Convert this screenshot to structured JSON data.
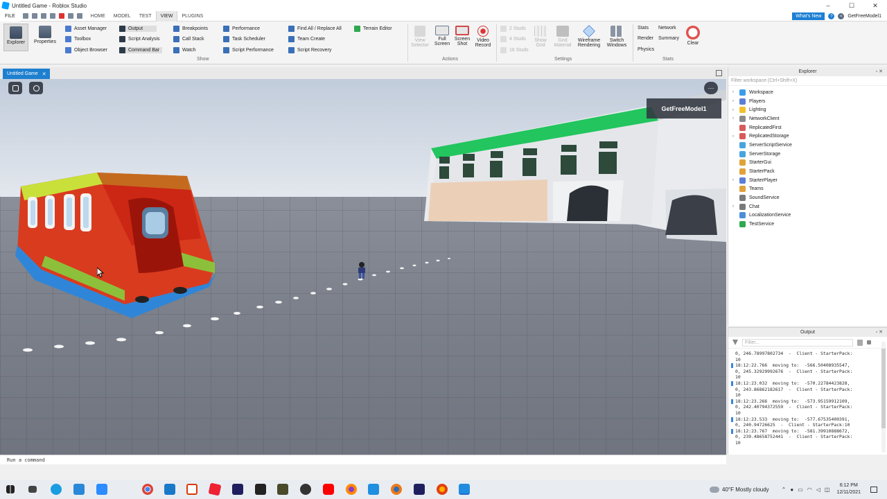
{
  "window": {
    "title": "Untitled Game - Roblox Studio",
    "controls": [
      "–",
      "☐",
      "✕"
    ]
  },
  "menu": {
    "file": "FILE",
    "tabs": [
      "HOME",
      "MODEL",
      "TEST",
      "VIEW",
      "PLUGINS"
    ],
    "active_tab": "VIEW",
    "whats_new": "What's New",
    "user": "GetFreeModel1"
  },
  "ribbon": {
    "explorer": "Explorer",
    "properties": "Properties",
    "show_col1": [
      "Asset Manager",
      "Toolbox",
      "Object Browser"
    ],
    "show_col2": [
      "Output",
      "Script Analysis",
      "Command Bar"
    ],
    "show_col3": [
      "Breakpoints",
      "Call Stack",
      "Watch"
    ],
    "show_col4": [
      "Performance",
      "Task Scheduler",
      "Script Performance"
    ],
    "show_col5": [
      "Find All / Replace All",
      "Team Create",
      "Script Recovery"
    ],
    "terrain_editor": "Terrain Editor",
    "show_label": "Show",
    "view_selector": [
      "View",
      "Selector"
    ],
    "full_screen": [
      "Full",
      "Screen"
    ],
    "screen_shot": [
      "Screen",
      "Shot"
    ],
    "video_record": [
      "Video",
      "Record"
    ],
    "actions_label": "Actions",
    "studs": [
      "2 Studs",
      "4 Studs",
      "16 Studs"
    ],
    "show_grid": [
      "Show",
      "Grid"
    ],
    "grid_material": [
      "Grid",
      "Material"
    ],
    "wireframe": [
      "Wireframe",
      "Rendering"
    ],
    "switch_windows": [
      "Switch",
      "Windows"
    ],
    "settings_label": "Settings",
    "stats_col1": [
      "Stats",
      "Render",
      "Physics"
    ],
    "stats_col2": [
      "Network",
      "Summary"
    ],
    "clear": "Clear",
    "stats_label": "Stats"
  },
  "doc_tab": {
    "label": "Untitled Game",
    "close": "✕"
  },
  "viewport": {
    "model_tag": "GetFreeModel1",
    "more": "⋯"
  },
  "command_bar": {
    "placeholder": "Run a command"
  },
  "explorer": {
    "title": "Explorer",
    "filter_placeholder": "Filter workspace (Ctrl+Shift+X)",
    "items": [
      {
        "label": "Workspace",
        "caret": "›",
        "color": "#3d9be9"
      },
      {
        "label": "Players",
        "caret": "›",
        "color": "#5b7fd6"
      },
      {
        "label": "Lighting",
        "caret": "›",
        "color": "#f2c12e"
      },
      {
        "label": "NetworkClient",
        "caret": "›",
        "color": "#8a8a8a"
      },
      {
        "label": "ReplicatedFirst",
        "caret": "",
        "color": "#d85a5a"
      },
      {
        "label": "ReplicatedStorage",
        "caret": "›",
        "color": "#d85a5a"
      },
      {
        "label": "ServerScriptService",
        "caret": "",
        "color": "#4aa3df"
      },
      {
        "label": "ServerStorage",
        "caret": "",
        "color": "#4aa3df"
      },
      {
        "label": "StarterGui",
        "caret": "",
        "color": "#e0a23a"
      },
      {
        "label": "StarterPack",
        "caret": "",
        "color": "#e0a23a"
      },
      {
        "label": "StarterPlayer",
        "caret": "›",
        "color": "#5b7fd6"
      },
      {
        "label": "Teams",
        "caret": "",
        "color": "#e0a23a"
      },
      {
        "label": "SoundService",
        "caret": "",
        "color": "#7a7a7a"
      },
      {
        "label": "Chat",
        "caret": "›",
        "color": "#7a7a7a"
      },
      {
        "label": "LocalizationService",
        "caret": "",
        "color": "#4a8fd8"
      },
      {
        "label": "TestService",
        "caret": "",
        "color": "#2fa84f"
      }
    ]
  },
  "output": {
    "title": "Output",
    "filter_placeholder": "Filter...",
    "lines": [
      "0, 246.78997802734  -  Client - StarterPack:\n10",
      "18:12:22.766  moving to:  -566.50408935547,\n0, 245.32929992676  -  Client - StarterPack:\n10",
      "18:12:23.032  moving to:  -570.22784423828,\n0, 243.86862182617  -  Client - StarterPack:\n10",
      "18:12:23.266  moving to:  -573.95159912109,\n0, 242.40794372559  -  Client - StarterPack:\n10",
      "18:12:23.533  moving to:  -577.67535400391,\n0, 240.94726625  -  Client - StarterPack:10",
      "18:12:23.767  moving to:  -581.39910888672,\n0, 239.48658752441  -  Client - StarterPack:\n10"
    ]
  },
  "taskbar": {
    "weather": "40°F  Mostly cloudy",
    "time": "6:12 PM",
    "date": "12/11/2021"
  }
}
